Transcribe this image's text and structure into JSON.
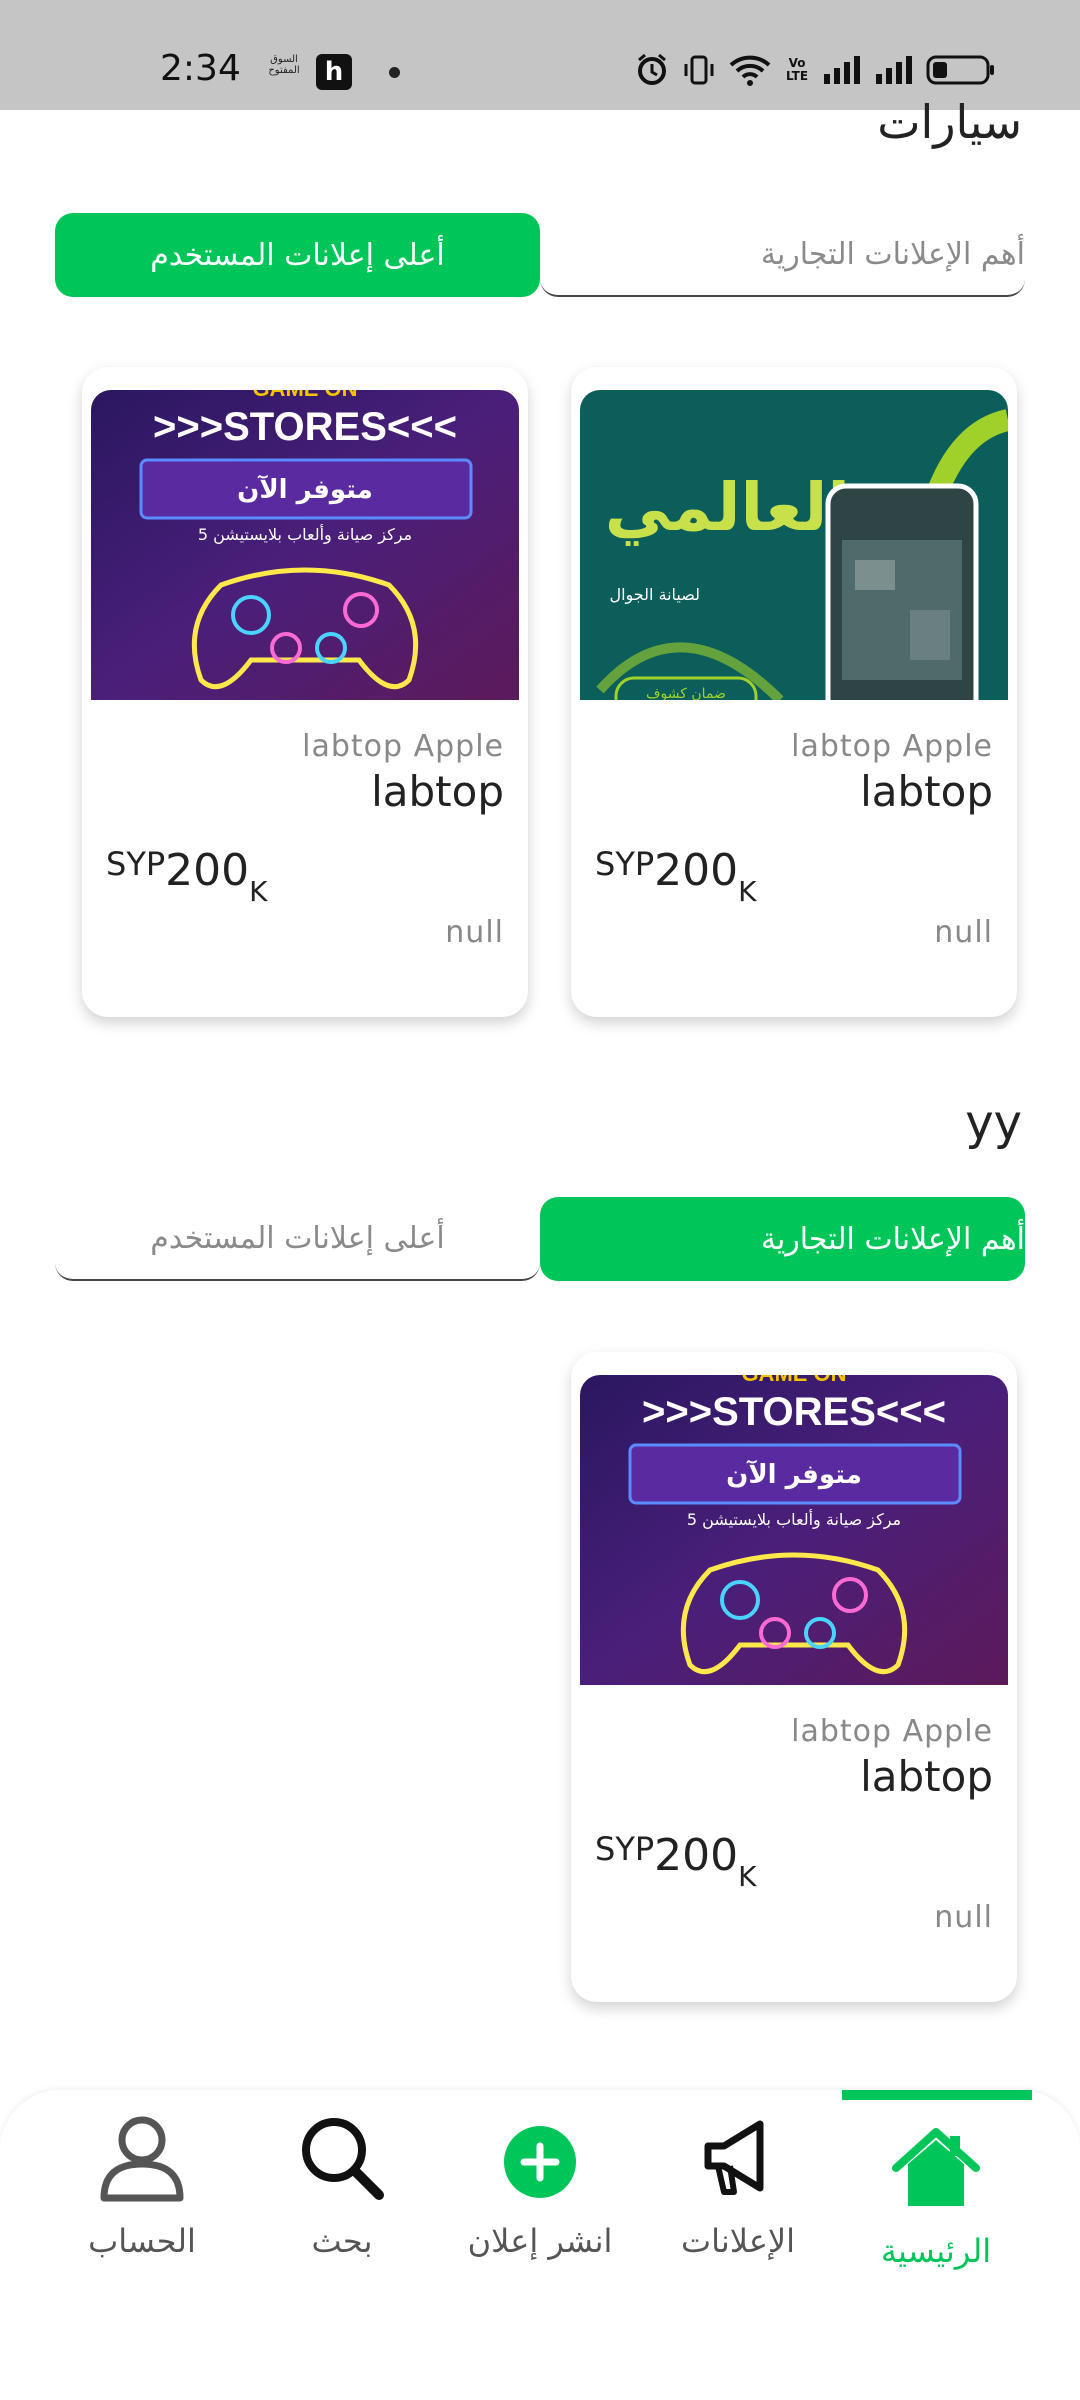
{
  "status_bar": {
    "time": "2:34",
    "app_label": "السوق المفتوح",
    "app_icon_letter": "h",
    "network_label": "Vo LTE"
  },
  "section1": {
    "heading": "سيارات",
    "tabs": [
      {
        "label": "أعلى إعلانات المستخدم",
        "active": true
      },
      {
        "label": "أهم الإعلانات التجارية",
        "active": false
      }
    ],
    "cards": [
      {
        "image": "game-on-stores-ad",
        "image_texts": [
          "GAME ON",
          ">>>STORES<<<",
          "متوفر الآن",
          "مركز صيانة وألعاب بلايستيشن 5"
        ],
        "subtitle": "labtop Apple",
        "title": "labtop",
        "currency": "SYP",
        "price": "200",
        "unit": "K",
        "location": "null"
      },
      {
        "image": "al-alami-phone-repair-ad",
        "image_texts": [
          "العالمي",
          "لصيانة الجوال",
          "ضمان كشوف"
        ],
        "subtitle": "labtop Apple",
        "title": "labtop",
        "currency": "SYP",
        "price": "200",
        "unit": "K",
        "location": "null"
      }
    ]
  },
  "section2": {
    "heading": "yy",
    "tabs": [
      {
        "label": "أعلى إعلانات المستخدم",
        "active": false
      },
      {
        "label": "أهم الإعلانات التجارية",
        "active": true
      }
    ],
    "cards": [
      {
        "image": "game-on-stores-ad",
        "image_texts": [
          "GAME ON",
          ">>>STORES<<<",
          "متوفر الآن",
          "مركز صيانة وألعاب بلايستيشن 5"
        ],
        "subtitle": "labtop Apple",
        "title": "labtop",
        "currency": "SYP",
        "price": "200",
        "unit": "K",
        "location": "null"
      }
    ]
  },
  "bottom_nav": {
    "items": [
      {
        "label": "الحساب",
        "icon": "person-icon"
      },
      {
        "label": "بحث",
        "icon": "search-icon"
      },
      {
        "label": "انشر إعلان",
        "icon": "add-circle-icon"
      },
      {
        "label": "الإعلانات",
        "icon": "megaphone-icon"
      },
      {
        "label": "الرئيسية",
        "icon": "home-icon",
        "active": true
      }
    ]
  },
  "colors": {
    "accent": "#00c65a",
    "status_bar": "#c5c5c5",
    "game_ad_bg": "#3b1a6e",
    "repair_ad_bg": "#0b5e59"
  }
}
